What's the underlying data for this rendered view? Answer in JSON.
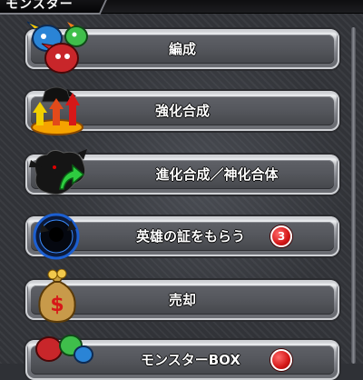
{
  "header": {
    "title": "モンスター"
  },
  "menu": {
    "items": [
      {
        "label": "編成",
        "icon": "monster-team-icon"
      },
      {
        "label": "強化合成",
        "icon": "power-up-arrows-icon"
      },
      {
        "label": "進化合成／神化合体",
        "icon": "evolution-dragon-icon"
      },
      {
        "label": "英雄の証をもらう",
        "icon": "hero-silhouette-icon",
        "badge": "3"
      },
      {
        "label": "売却",
        "icon": "money-bag-icon"
      },
      {
        "label": "モンスターBOX",
        "icon": "monster-box-icon",
        "badge": ""
      }
    ]
  },
  "colors": {
    "badge": "#d41616",
    "accent_arrow": "#2ecc40"
  }
}
